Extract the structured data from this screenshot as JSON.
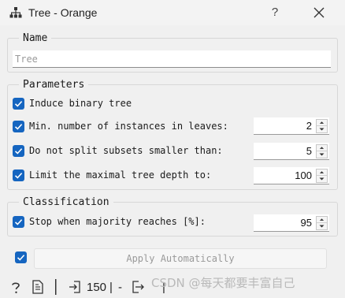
{
  "window": {
    "title": "Tree - Orange",
    "help_label": "?"
  },
  "name_group": {
    "title": "Name",
    "input_placeholder": "Tree",
    "input_value": ""
  },
  "parameters": {
    "title": "Parameters",
    "items": [
      {
        "label": "Induce binary tree",
        "checked": true
      },
      {
        "label": "Min. number of instances in leaves:",
        "checked": true,
        "value": "2"
      },
      {
        "label": "Do not split subsets smaller than:",
        "checked": true,
        "value": "5"
      },
      {
        "label": "Limit the maximal tree depth to:",
        "checked": true,
        "value": "100"
      }
    ]
  },
  "classification": {
    "title": "Classification",
    "items": [
      {
        "label": "Stop when majority reaches [%]:",
        "checked": true,
        "value": "95"
      }
    ]
  },
  "apply": {
    "checked": true,
    "label": "Apply Automatically"
  },
  "status": {
    "count": "150",
    "separator": "|",
    "dash": "-",
    "trailing": "|"
  },
  "watermark": "CSDN @每天都要丰富自己",
  "colors": {
    "accent": "#1565c0",
    "background": "#f0f0f0"
  },
  "icons": {
    "app": "tree-icon",
    "close": "close-icon",
    "help": "help-question-icon",
    "report": "report-icon",
    "input": "input-signal-icon",
    "output": "output-signal-icon"
  }
}
